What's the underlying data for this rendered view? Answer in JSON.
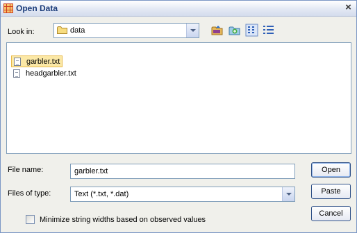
{
  "window": {
    "title": "Open Data",
    "close_symbol": "×"
  },
  "look_in": {
    "label": "Look in:",
    "value": "data"
  },
  "toolbar": {
    "buttons": [
      {
        "name": "up-one-level-icon"
      },
      {
        "name": "new-folder-icon"
      },
      {
        "name": "list-view-icon"
      },
      {
        "name": "details-view-icon"
      }
    ]
  },
  "files": [
    {
      "name": "garbler.txt",
      "selected": true
    },
    {
      "name": "headgarbler.txt",
      "selected": false
    }
  ],
  "file_name": {
    "label": "File name:",
    "value": "garbler.txt"
  },
  "files_of_type": {
    "label": "Files of type:",
    "value": "Text (*.txt, *.dat)"
  },
  "buttons": {
    "open": "Open",
    "paste": "Paste",
    "cancel": "Cancel"
  },
  "option": {
    "label": "Minimize string widths based on observed values",
    "checked": false
  },
  "colors": {
    "title": "#1b3c7a",
    "selection": "#fbe8a6",
    "border": "#7f9db9"
  }
}
